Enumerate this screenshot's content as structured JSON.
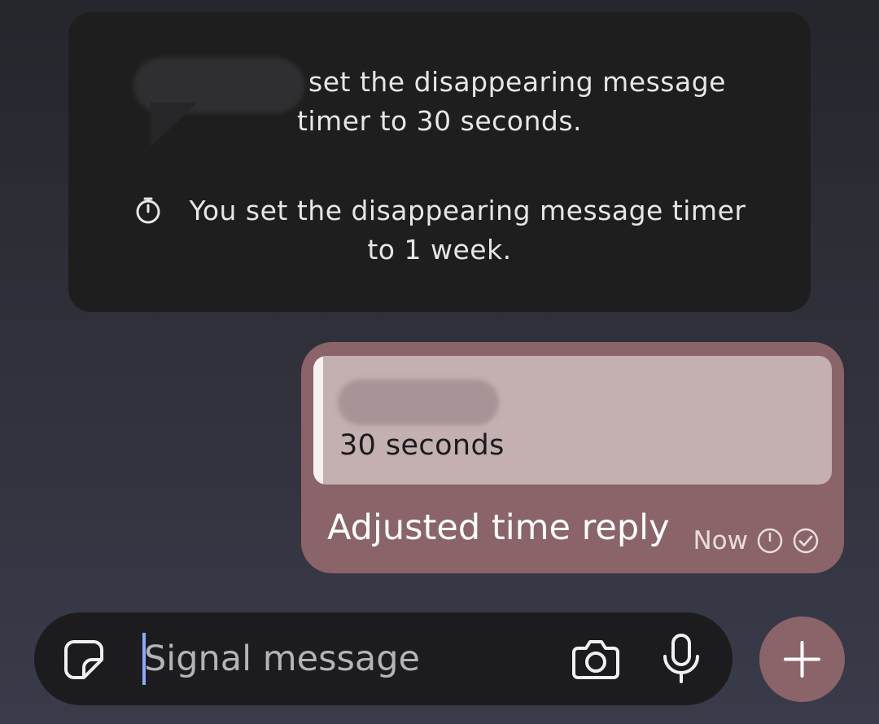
{
  "updates": [
    {
      "text": "set the disappearing message timer to 30 seconds.",
      "line1": "set the disappearing message",
      "line2": "timer to 30 seconds.",
      "icon": "redacted-avatar"
    },
    {
      "text": "You set the disappearing message timer to 1 week.",
      "line1": "You set the disappearing message timer",
      "line2": "to 1 week.",
      "icon": "timer-icon"
    }
  ],
  "message": {
    "quote": {
      "text": "30 seconds"
    },
    "body": "Adjusted time reply",
    "time": "Now",
    "icons": [
      "timer-icon",
      "sent-check-icon"
    ]
  },
  "composer": {
    "placeholder": "Signal message",
    "icons": [
      "sticker-icon",
      "camera-icon",
      "microphone-icon",
      "plus-icon"
    ]
  },
  "colors": {
    "background": "#2f3039",
    "panel": "#1e1e1e",
    "bubble": "#8a6469",
    "quote": "#c4afb1",
    "composer": "#1c1c1f",
    "caret": "#8da8ff"
  }
}
